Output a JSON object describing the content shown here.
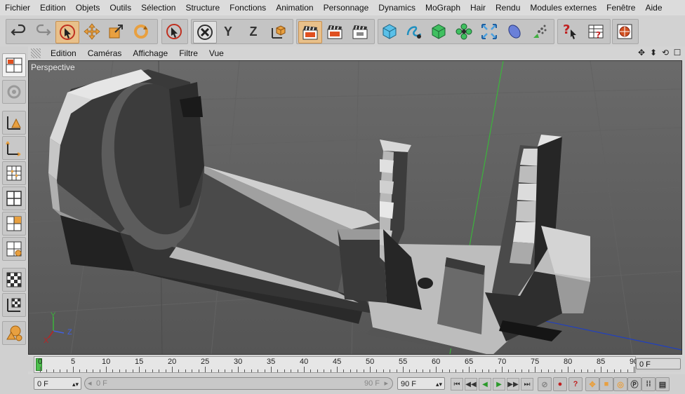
{
  "menu": [
    "Fichier",
    "Edition",
    "Objets",
    "Outils",
    "Sélection",
    "Structure",
    "Fonctions",
    "Animation",
    "Personnage",
    "Dynamics",
    "MoGraph",
    "Hair",
    "Rendu",
    "Modules externes",
    "Fenêtre",
    "Aide"
  ],
  "toolbar": {
    "z_label": "Z",
    "y_label": "Y",
    "x_label": "X"
  },
  "viewport_menu": [
    "Edition",
    "Caméras",
    "Affichage",
    "Filtre",
    "Vue"
  ],
  "viewport": {
    "label": "Perspective",
    "axis_y": "Y",
    "axis_z": "Z",
    "axis_x": "X"
  },
  "timeline": {
    "start": 0,
    "end": 90,
    "step": 5,
    "current_frame": "0 F"
  },
  "transport": {
    "start_field": "0 F",
    "range_min": "0 F",
    "range_max": "90 F",
    "end_field": "90 F"
  },
  "colors": {
    "accent": "#e8a040",
    "play_green": "#2a9a2a",
    "record_red": "#c02020",
    "axis_green": "#3cb43c",
    "axis_blue": "#2040c0"
  }
}
